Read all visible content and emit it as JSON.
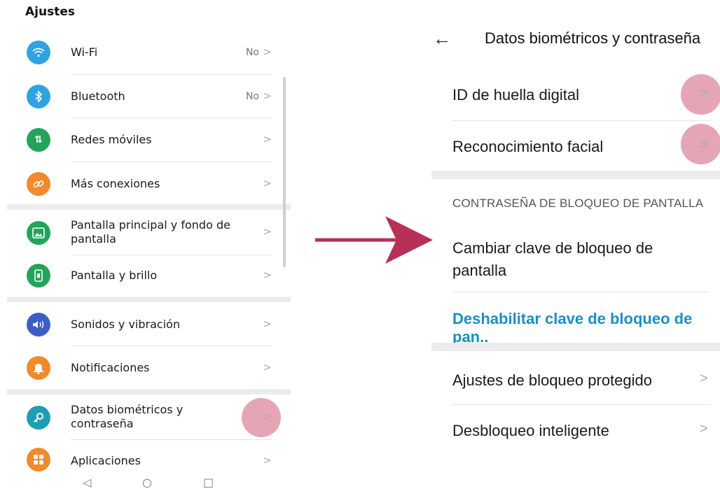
{
  "left_screen": {
    "title": "Ajustes",
    "items": [
      {
        "label": "Wi-Fi",
        "value": "No",
        "icon": "wifi-icon",
        "color": "#2fa3e0"
      },
      {
        "label": "Bluetooth",
        "value": "No",
        "icon": "bluetooth-icon",
        "color": "#2fa3e0"
      },
      {
        "label": "Redes móviles",
        "value": "",
        "icon": "mobile-data-icon",
        "color": "#23a45a"
      },
      {
        "label": "Más conexiones",
        "value": "",
        "icon": "link-icon",
        "color": "#f08a2c"
      },
      {
        "label": "Pantalla principal y fondo de pantalla",
        "value": "",
        "icon": "wallpaper-icon",
        "color": "#23a45a"
      },
      {
        "label": "Pantalla y brillo",
        "value": "",
        "icon": "display-icon",
        "color": "#23a45a"
      },
      {
        "label": "Sonidos y vibración",
        "value": "",
        "icon": "sound-icon",
        "color": "#3b5fc4"
      },
      {
        "label": "Notificaciones",
        "value": "",
        "icon": "bell-icon",
        "color": "#f08a2c"
      },
      {
        "label": "Datos biométricos y contraseña",
        "value": "",
        "icon": "key-icon",
        "color": "#1e9eb5"
      },
      {
        "label": "Aplicaciones",
        "value": "",
        "icon": "apps-icon",
        "color": "#f08a2c"
      }
    ],
    "chevron": ">",
    "navbar": {
      "back": "◁",
      "home": "○",
      "recent": "□"
    }
  },
  "right_screen": {
    "back_icon": "←",
    "title": "Datos biométricos y contraseña",
    "fingerprint": "ID de huella digital",
    "face": "Reconocimiento facial",
    "section_header": "CONTRASEÑA DE BLOQUEO DE PANTALLA",
    "change_lock_line1": "Cambiar clave de bloqueo de",
    "change_lock_line2": "pantalla",
    "disable_lock": "Deshabilitar clave de bloqueo de pan..",
    "secure_lock": "Ajustes de bloqueo protegido",
    "smart_unlock": "Desbloqueo inteligente",
    "chevron": ">"
  },
  "colors": {
    "highlight": "#d5768c",
    "arrow": "#b83055",
    "link": "#1a8fc3"
  }
}
